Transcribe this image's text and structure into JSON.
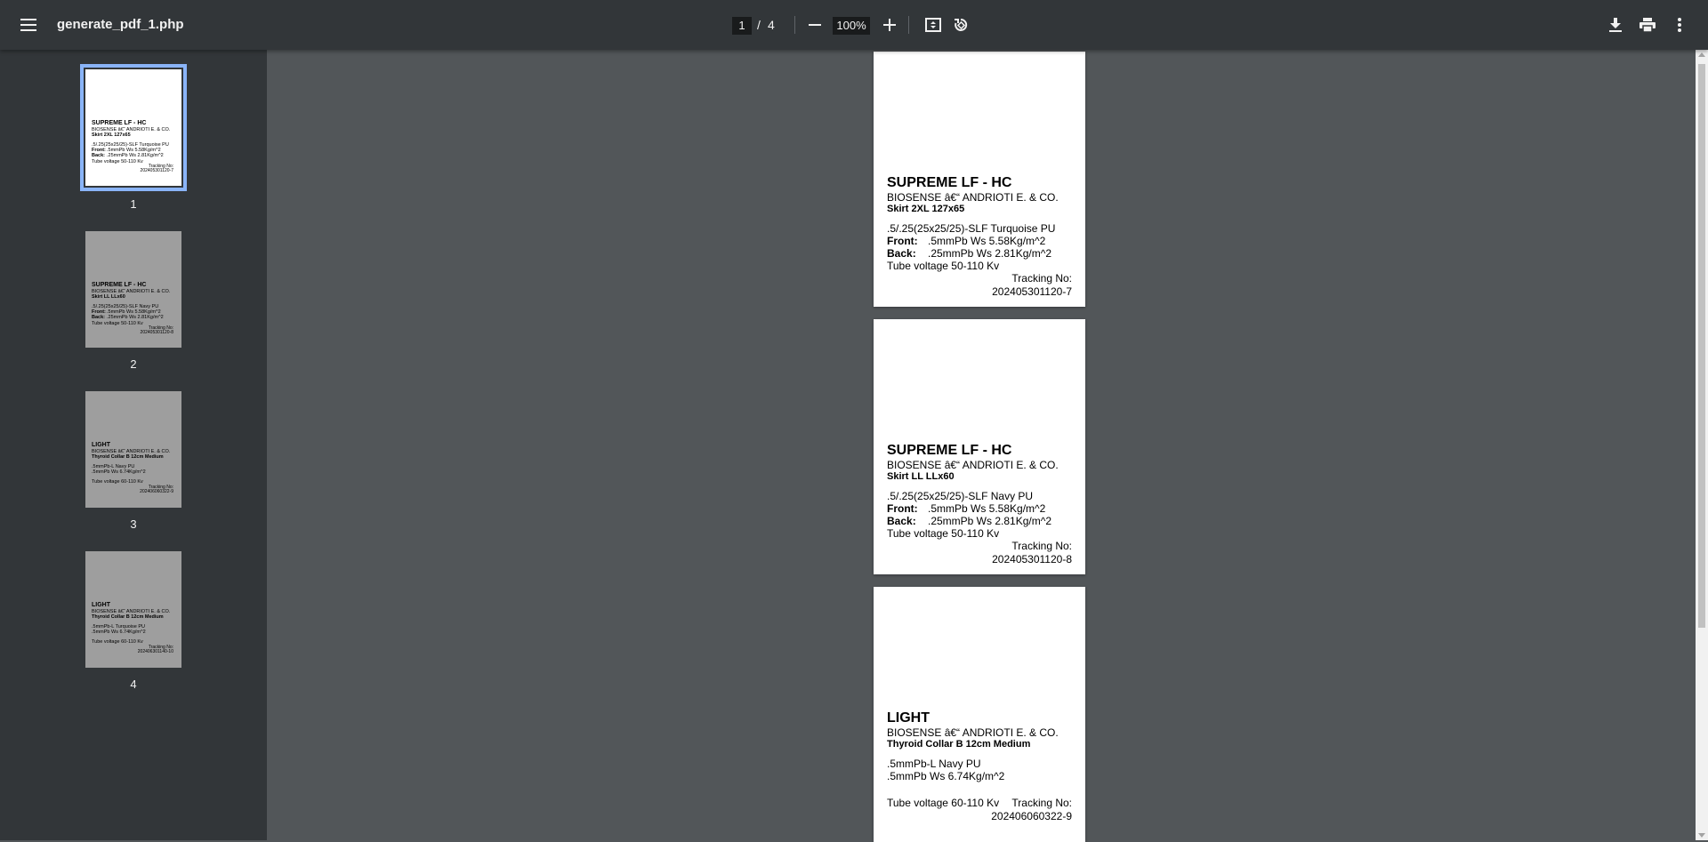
{
  "toolbar": {
    "title": "generate_pdf_1.php",
    "current_page": "1",
    "page_separator": "/",
    "total_pages": "4",
    "zoom": "100%",
    "icons": [
      "menu-icon",
      "minus-icon",
      "plus-icon",
      "fit-page-icon",
      "rotate-icon",
      "download-icon",
      "print-icon",
      "more-vert-icon"
    ]
  },
  "thumbnails": [
    {
      "label": "1"
    },
    {
      "label": "2"
    },
    {
      "label": "3"
    },
    {
      "label": "4"
    }
  ],
  "pages": [
    {
      "title": "SUPREME LF - HC",
      "company": "BIOSENSE â€“ ANDRIOTI E. & CO.",
      "product": "Skirt 2XL 127x65",
      "spec": ".5/.25(25x25/25)-SLF Turquoise PU",
      "front_label": "Front:",
      "front_value": ".5mmPb  Ws 5.58Kg/m^2",
      "back_label": "Back:",
      "back_value": ".25mmPb  Ws 2.81Kg/m^2",
      "voltage": "Tube voltage 50-110 Kv",
      "tracking_label": "Tracking No:",
      "tracking_no": "202405301120-7"
    },
    {
      "title": "SUPREME LF - HC",
      "company": "BIOSENSE â€“ ANDRIOTI E. & CO.",
      "product": "Skirt LL LLx60",
      "spec": ".5/.25(25x25/25)-SLF Navy PU",
      "front_label": "Front:",
      "front_value": ".5mmPb  Ws 5.58Kg/m^2",
      "back_label": "Back:",
      "back_value": ".25mmPb  Ws 2.81Kg/m^2",
      "voltage": "Tube voltage 50-110 Kv",
      "tracking_label": "Tracking No:",
      "tracking_no": "202405301120-8"
    },
    {
      "title": "LIGHT",
      "company": "BIOSENSE â€“ ANDRIOTI E. & CO.",
      "product": "Thyroid Collar B 12cm Medium",
      "spec": ".5mmPb-L Navy PU",
      "line2": ".5mmPb Ws 6.74Kg/m^2",
      "voltage": "Tube voltage 60-110 Kv",
      "tracking_label": "Tracking No:",
      "tracking_no": "202406060322-9"
    }
  ],
  "thumb_texts": [
    {
      "title": "SUPREME LF - HC",
      "company": "BIOSENSE â€“ ANDRIOTI E. & CO.",
      "product": "Skirt 2XL 127x65",
      "spec": ".5/.25(25x25/25)-SLF Turquoise PU",
      "front_label": "Front:",
      "front_value": ".5mmPb  Ws 5.58Kg/m^2",
      "back_label": "Back:",
      "back_value": ".25mmPb  Ws 2.81Kg/m^2",
      "voltage": "Tube voltage 50-110 Kv",
      "tracking_label": "Tracking No:",
      "tracking_no": "202405301120-7"
    },
    {
      "title": "SUPREME LF - HC",
      "company": "BIOSENSE â€“ ANDRIOTI E. & CO.",
      "product": "Skirt LL LLx60",
      "spec": ".5/.25(25x25/25)-SLF Navy PU",
      "front_label": "Front:",
      "front_value": ".5mmPb  Ws 5.58Kg/m^2",
      "back_label": "Back:",
      "back_value": ".25mmPb  Ws 2.81Kg/m^2",
      "voltage": "Tube voltage 50-110 Kv",
      "tracking_label": "Tracking No:",
      "tracking_no": "202405301120-8"
    },
    {
      "title": "LIGHT",
      "company": "BIOSENSE â€“ ANDRIOTI E. & CO.",
      "product": "Thyroid Collar B 12cm Medium",
      "spec": ".5mmPb-L Navy PU",
      "line2": ".5mmPb Ws 6.74Kg/m^2",
      "voltage": "Tube voltage 60-110 Kv",
      "tracking_label": "Tracking No:",
      "tracking_no": "202406060322-9"
    },
    {
      "title": "LIGHT",
      "company": "BIOSENSE â€“ ANDRIOTI E. & CO.",
      "product": "Thyroid Collar B 12cm Medium",
      "spec": ".5mmPb-L Turquoise PU",
      "line2": ".5mmPb Ws 6.74Kg/m^2",
      "voltage": "Tube voltage 60-110 Kv",
      "tracking_label": "Tracking No:",
      "tracking_no": "202406301140-10"
    }
  ],
  "colors": {
    "toolbar_bg": "#323639",
    "viewer_bg": "#525659",
    "selection": "#8ab4f8"
  }
}
